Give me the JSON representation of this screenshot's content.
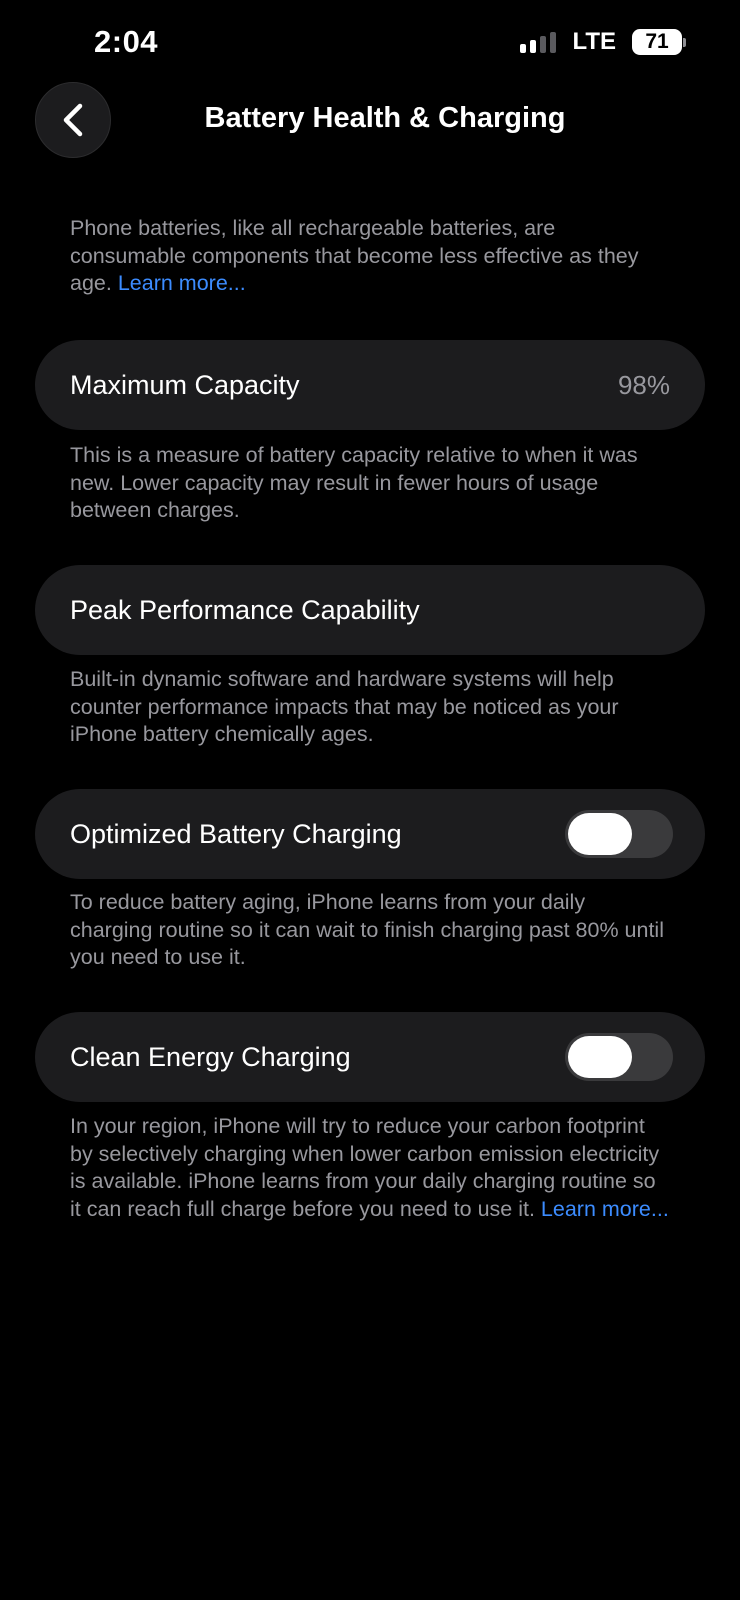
{
  "status_bar": {
    "time": "2:04",
    "network": "LTE",
    "battery_level": "71",
    "signal_bars_active": 2,
    "signal_bars_total": 4
  },
  "nav": {
    "back_icon": "chevron-left-icon",
    "title": "Battery Health & Charging"
  },
  "intro": {
    "text": "Phone batteries, like all rechargeable batteries, are consumable components that become less effective as they age.",
    "link": "Learn more..."
  },
  "maximum_capacity": {
    "label": "Maximum Capacity",
    "value": "98%",
    "description": "This is a measure of battery capacity relative to when it was new. Lower capacity may result in fewer hours of usage between charges."
  },
  "peak_performance": {
    "label": "Peak Performance Capability",
    "description": "Built-in dynamic software and hardware systems will help counter performance impacts that may be noticed as your iPhone battery chemically ages."
  },
  "optimized_charging": {
    "label": "Optimized Battery Charging",
    "enabled": false,
    "description": "To reduce battery aging, iPhone learns from your daily charging routine so it can wait to finish charging past 80% until you need to use it."
  },
  "clean_energy": {
    "label": "Clean Energy Charging",
    "enabled": false,
    "description": "In your region, iPhone will try to reduce your carbon footprint by selectively charging when lower carbon emission electricity is available. iPhone learns from your daily charging routine so it can reach full charge before you need to use it.",
    "link": "Learn more..."
  },
  "colors": {
    "background": "#000000",
    "cell": "#1c1c1e",
    "secondary_text": "#98989e",
    "link": "#3c8cff",
    "toggle_off": "#3a3a3c"
  }
}
